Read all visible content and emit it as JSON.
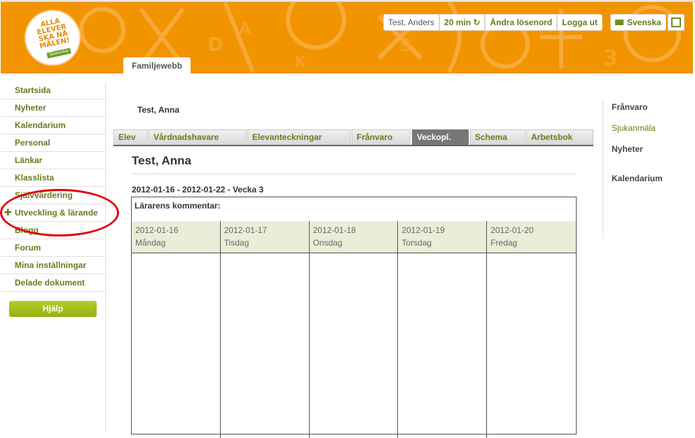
{
  "header": {
    "logo_text": "ALLA\nELEVER\nSKA NÅ\nMÅLEN!",
    "logo_badge": "Skolverket",
    "tab_label": "Familjewebb",
    "user_name": "Test, Anders",
    "session_time": "20 min",
    "change_password": "Ändra lösenord",
    "logout": "Logga ut",
    "language": "Svenska"
  },
  "sidebar": {
    "items": [
      {
        "label": "Startsida"
      },
      {
        "label": "Nyheter"
      },
      {
        "label": "Kalendarium"
      },
      {
        "label": "Personal"
      },
      {
        "label": "Länkar"
      },
      {
        "label": "Klasslista"
      },
      {
        "label": "Självvärdering"
      },
      {
        "label": "Utveckling & lärande"
      },
      {
        "label": "Blogg"
      },
      {
        "label": "Forum"
      },
      {
        "label": "Mina inställningar"
      },
      {
        "label": "Delade dokument"
      }
    ],
    "help_label": "Hjälp"
  },
  "main": {
    "student_name": "Test, Anna",
    "tabs": [
      {
        "label": "Elev"
      },
      {
        "label": "Vårdnadshavare"
      },
      {
        "label": "Elevanteckningar"
      },
      {
        "label": "Frånvaro"
      },
      {
        "label": "Veckopl."
      },
      {
        "label": "Schema"
      },
      {
        "label": "Arbetsbok"
      }
    ],
    "title": "Test, Anna",
    "week": "2012-01-16 - 2012-01-22 - Vecka 3",
    "comment_label": "Lärarens kommentar:",
    "days": [
      {
        "date": "2012-01-16",
        "name": "Måndag"
      },
      {
        "date": "2012-01-17",
        "name": "Tisdag"
      },
      {
        "date": "2012-01-18",
        "name": "Onsdag"
      },
      {
        "date": "2012-01-19",
        "name": "Torsdag"
      },
      {
        "date": "2012-01-20",
        "name": "Fredag"
      }
    ]
  },
  "right_panel": {
    "franvaro": "Frånvaro",
    "sjukanmala": "Sjukanmäla",
    "nyheter": "Nyheter",
    "kalendarium": "Kalendarium"
  },
  "colors": {
    "header_orange": "#f29400",
    "link_olive": "#6b7a1e",
    "active_tab": "#777777",
    "day_header_bg": "#e9eed8",
    "annotation_red": "#e10010"
  }
}
